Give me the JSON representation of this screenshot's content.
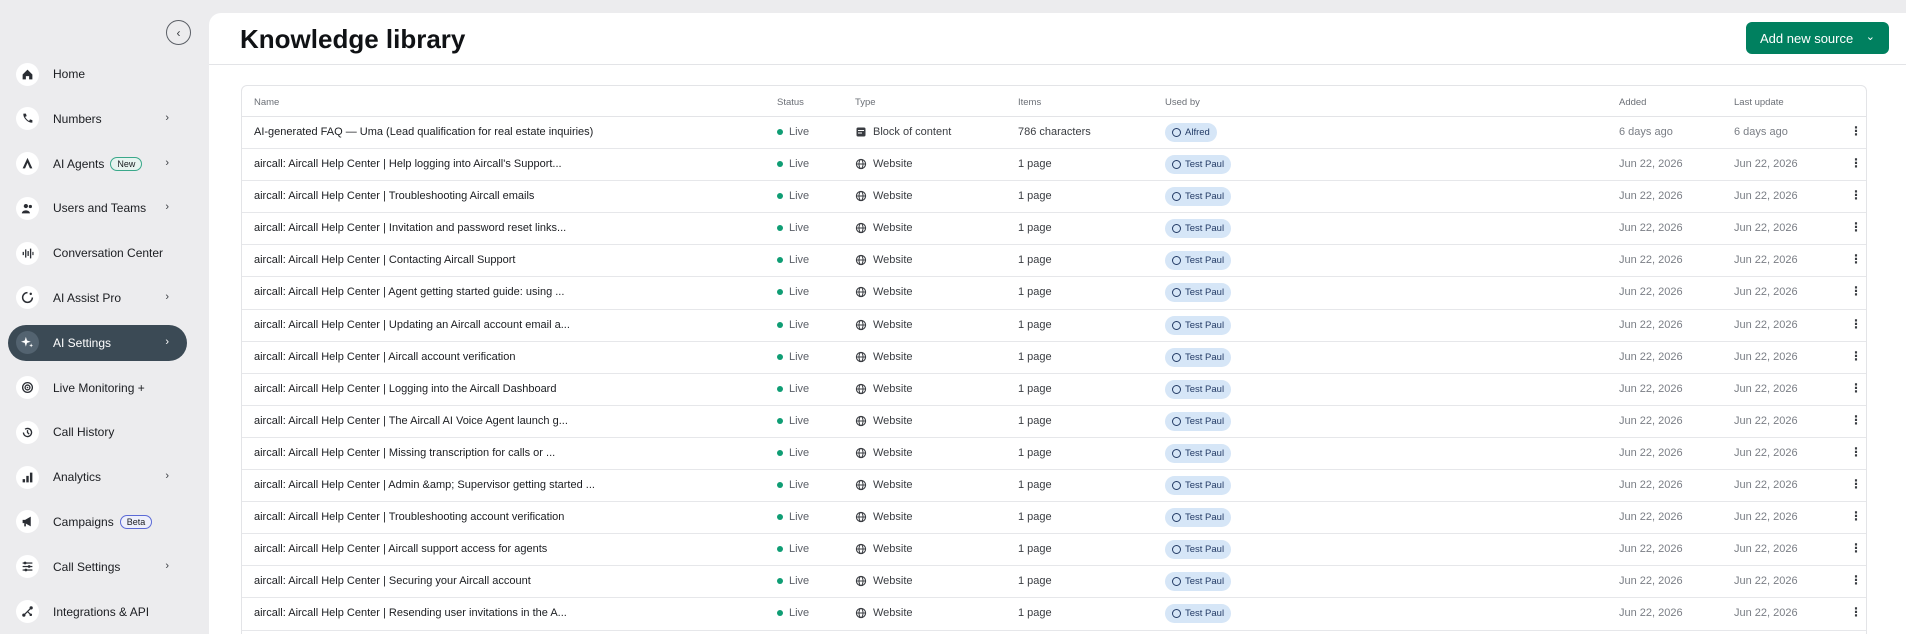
{
  "sidebar": {
    "collapse_glyph": "‹",
    "items": [
      {
        "label": "Home",
        "icon": "home-icon",
        "chevron": false,
        "badge": ""
      },
      {
        "label": "Numbers",
        "icon": "phone-icon",
        "chevron": true,
        "badge": ""
      },
      {
        "label": "AI Agents",
        "icon": "ai-agent-icon",
        "chevron": true,
        "badge": "New"
      },
      {
        "label": "Users and Teams",
        "icon": "users-icon",
        "chevron": true,
        "badge": ""
      },
      {
        "label": "Conversation Center",
        "icon": "waveform-icon",
        "chevron": false,
        "badge": ""
      },
      {
        "label": "AI Assist Pro",
        "icon": "assist-icon",
        "chevron": true,
        "badge": ""
      },
      {
        "label": "AI Settings",
        "icon": "sparkle-icon",
        "chevron": true,
        "badge": "",
        "active": true
      },
      {
        "label": "Live Monitoring +",
        "icon": "monitoring-icon",
        "chevron": false,
        "badge": ""
      },
      {
        "label": "Call History",
        "icon": "history-icon",
        "chevron": false,
        "badge": ""
      },
      {
        "label": "Analytics",
        "icon": "bar-chart-icon",
        "chevron": true,
        "badge": ""
      },
      {
        "label": "Campaigns",
        "icon": "megaphone-icon",
        "chevron": false,
        "badge": "Beta"
      },
      {
        "label": "Call Settings",
        "icon": "sliders-icon",
        "chevron": true,
        "badge": ""
      },
      {
        "label": "Integrations & API",
        "icon": "integrations-icon",
        "chevron": false,
        "badge": ""
      }
    ]
  },
  "header": {
    "title": "Knowledge library",
    "add_button_label": "Add new source",
    "add_button_caret": "⌄"
  },
  "table": {
    "columns": {
      "name": "Name",
      "status": "Status",
      "type": "Type",
      "items": "Items",
      "used_by": "Used by",
      "added": "Added",
      "last_update": "Last update"
    },
    "more_glyph": "⋮",
    "rows": [
      {
        "name": "AI-generated FAQ — Uma (Lead qualification for real estate inquiries)",
        "status": "Live",
        "type": "Block of content",
        "type_icon": "block-icon",
        "items": "786 characters",
        "used_by": "Alfred",
        "added": "6 days ago",
        "updated": "6 days ago"
      },
      {
        "name": "aircall: Aircall Help Center | Help logging into Aircall's Support...",
        "status": "Live",
        "type": "Website",
        "type_icon": "globe-icon",
        "items": "1 page",
        "used_by": "Test Paul",
        "added": "Jun 22, 2026",
        "updated": "Jun 22, 2026"
      },
      {
        "name": "aircall: Aircall Help Center | Troubleshooting Aircall emails",
        "status": "Live",
        "type": "Website",
        "type_icon": "globe-icon",
        "items": "1 page",
        "used_by": "Test Paul",
        "added": "Jun 22, 2026",
        "updated": "Jun 22, 2026"
      },
      {
        "name": "aircall: Aircall Help Center | Invitation and password reset links...",
        "status": "Live",
        "type": "Website",
        "type_icon": "globe-icon",
        "items": "1 page",
        "used_by": "Test Paul",
        "added": "Jun 22, 2026",
        "updated": "Jun 22, 2026"
      },
      {
        "name": "aircall: Aircall Help Center | Contacting Aircall Support",
        "status": "Live",
        "type": "Website",
        "type_icon": "globe-icon",
        "items": "1 page",
        "used_by": "Test Paul",
        "added": "Jun 22, 2026",
        "updated": "Jun 22, 2026"
      },
      {
        "name": "aircall: Aircall Help Center | Agent getting started guide: using ...",
        "status": "Live",
        "type": "Website",
        "type_icon": "globe-icon",
        "items": "1 page",
        "used_by": "Test Paul",
        "added": "Jun 22, 2026",
        "updated": "Jun 22, 2026"
      },
      {
        "name": "aircall: Aircall Help Center | Updating an Aircall account email a...",
        "status": "Live",
        "type": "Website",
        "type_icon": "globe-icon",
        "items": "1 page",
        "used_by": "Test Paul",
        "added": "Jun 22, 2026",
        "updated": "Jun 22, 2026"
      },
      {
        "name": "aircall: Aircall Help Center | Aircall account verification",
        "status": "Live",
        "type": "Website",
        "type_icon": "globe-icon",
        "items": "1 page",
        "used_by": "Test Paul",
        "added": "Jun 22, 2026",
        "updated": "Jun 22, 2026"
      },
      {
        "name": "aircall: Aircall Help Center | Logging into the Aircall Dashboard",
        "status": "Live",
        "type": "Website",
        "type_icon": "globe-icon",
        "items": "1 page",
        "used_by": "Test Paul",
        "added": "Jun 22, 2026",
        "updated": "Jun 22, 2026"
      },
      {
        "name": "aircall: Aircall Help Center | The Aircall AI Voice Agent launch g...",
        "status": "Live",
        "type": "Website",
        "type_icon": "globe-icon",
        "items": "1 page",
        "used_by": "Test Paul",
        "added": "Jun 22, 2026",
        "updated": "Jun 22, 2026"
      },
      {
        "name": "aircall: Aircall Help Center | Missing transcription for calls or ...",
        "status": "Live",
        "type": "Website",
        "type_icon": "globe-icon",
        "items": "1 page",
        "used_by": "Test Paul",
        "added": "Jun 22, 2026",
        "updated": "Jun 22, 2026"
      },
      {
        "name": "aircall: Aircall Help Center | Admin &amp; Supervisor getting started ...",
        "status": "Live",
        "type": "Website",
        "type_icon": "globe-icon",
        "items": "1 page",
        "used_by": "Test Paul",
        "added": "Jun 22, 2026",
        "updated": "Jun 22, 2026"
      },
      {
        "name": "aircall: Aircall Help Center | Troubleshooting account verification",
        "status": "Live",
        "type": "Website",
        "type_icon": "globe-icon",
        "items": "1 page",
        "used_by": "Test Paul",
        "added": "Jun 22, 2026",
        "updated": "Jun 22, 2026"
      },
      {
        "name": "aircall: Aircall Help Center | Aircall support access for agents",
        "status": "Live",
        "type": "Website",
        "type_icon": "globe-icon",
        "items": "1 page",
        "used_by": "Test Paul",
        "added": "Jun 22, 2026",
        "updated": "Jun 22, 2026"
      },
      {
        "name": "aircall: Aircall Help Center | Securing your Aircall account",
        "status": "Live",
        "type": "Website",
        "type_icon": "globe-icon",
        "items": "1 page",
        "used_by": "Test Paul",
        "added": "Jun 22, 2026",
        "updated": "Jun 22, 2026"
      },
      {
        "name": "aircall: Aircall Help Center | Resending user invitations in the A...",
        "status": "Live",
        "type": "Website",
        "type_icon": "globe-icon",
        "items": "1 page",
        "used_by": "Test Paul",
        "added": "Jun 22, 2026",
        "updated": "Jun 22, 2026"
      }
    ]
  },
  "colors": {
    "accent": "#00805f",
    "active_nav": "#3b4a55",
    "live_dot": "#0f9d74",
    "pill_bg": "#d6e6f7"
  }
}
